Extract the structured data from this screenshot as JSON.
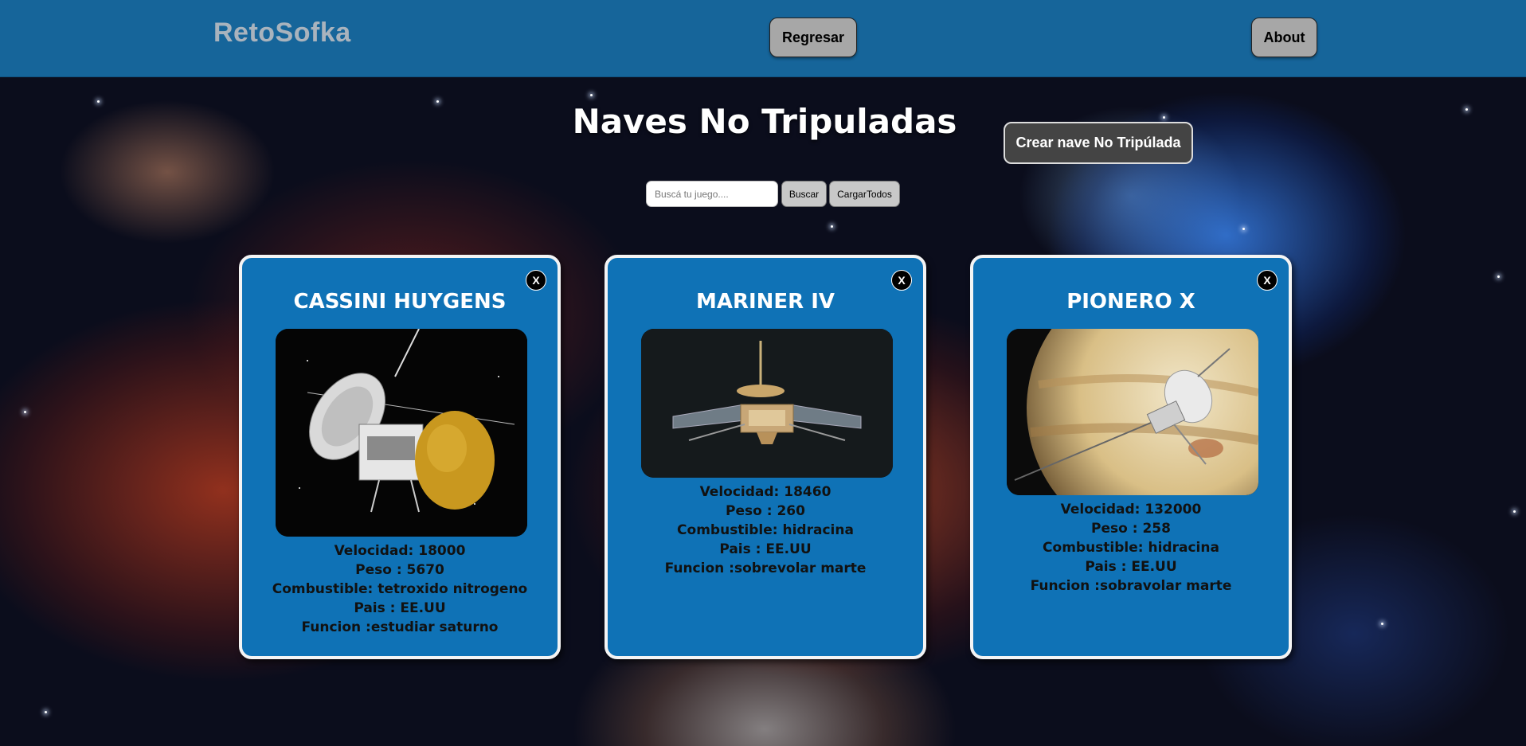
{
  "navbar": {
    "brand": "RetoSofka",
    "back_label": "Regresar",
    "about_label": "About"
  },
  "page": {
    "title": "Naves No Tripuladas",
    "create_label": "Crear nave No Tripúlada"
  },
  "search": {
    "placeholder": "Buscá tu juego....",
    "value": "",
    "search_label": "Buscar",
    "load_all_label": "CargarTodos"
  },
  "cards": [
    {
      "name": "CASSINI HUYGENS",
      "close_label": "X",
      "velocidad": "Velocidad: 18000",
      "peso": "Peso : 5670",
      "combustible": "Combustible: tetroxido nitrogeno",
      "pais": "Pais : EE.UU",
      "funcion": "Funcion :estudiar saturno"
    },
    {
      "name": "MARINER IV",
      "close_label": "X",
      "velocidad": "Velocidad: 18460",
      "peso": "Peso : 260",
      "combustible": "Combustible: hidracina",
      "pais": "Pais : EE.UU",
      "funcion": "Funcion :sobrevolar marte"
    },
    {
      "name": "PIONERO X",
      "close_label": "X",
      "velocidad": "Velocidad: 132000",
      "peso": "Peso : 258",
      "combustible": "Combustible: hidracina",
      "pais": "Pais : EE.UU",
      "funcion": "Funcion :sobravolar marte"
    }
  ],
  "colors": {
    "navbar": "#16659a",
    "card": "#0f72b6",
    "brand_text": "#a9b3bd"
  }
}
